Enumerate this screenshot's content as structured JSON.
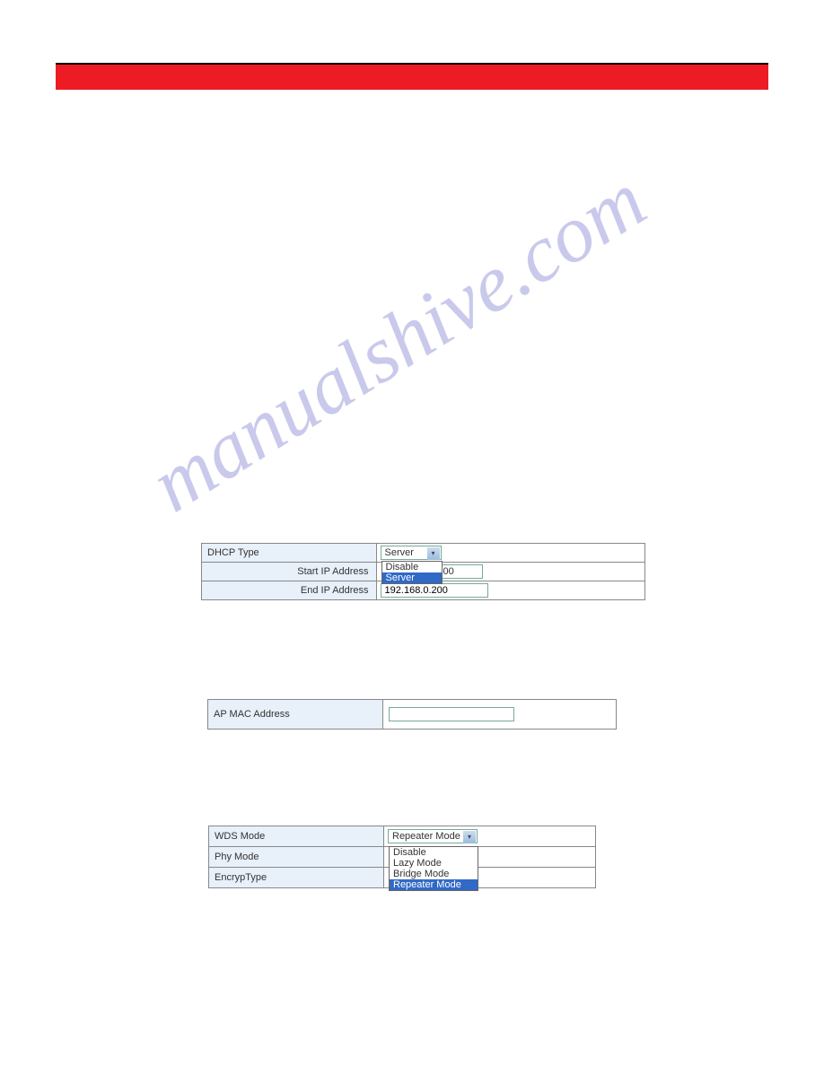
{
  "watermark": "manualshive.com",
  "dhcp": {
    "type_label": "DHCP Type",
    "type_selected": "Server",
    "type_options": {
      "disable": "Disable",
      "server": "Server"
    },
    "start_label": "Start IP Address",
    "start_partial": "00",
    "end_label": "End IP Address",
    "end_value": "192.168.0.200"
  },
  "ap": {
    "mac_label": "AP MAC Address",
    "mac_value": ""
  },
  "wds": {
    "mode_label": "WDS Mode",
    "mode_selected": "Repeater Mode",
    "phy_label": "Phy Mode",
    "encrypt_label": "EncrypType",
    "options": {
      "disable": "Disable",
      "lazy": "Lazy Mode",
      "bridge": "Bridge Mode",
      "repeater": "Repeater Mode"
    }
  }
}
